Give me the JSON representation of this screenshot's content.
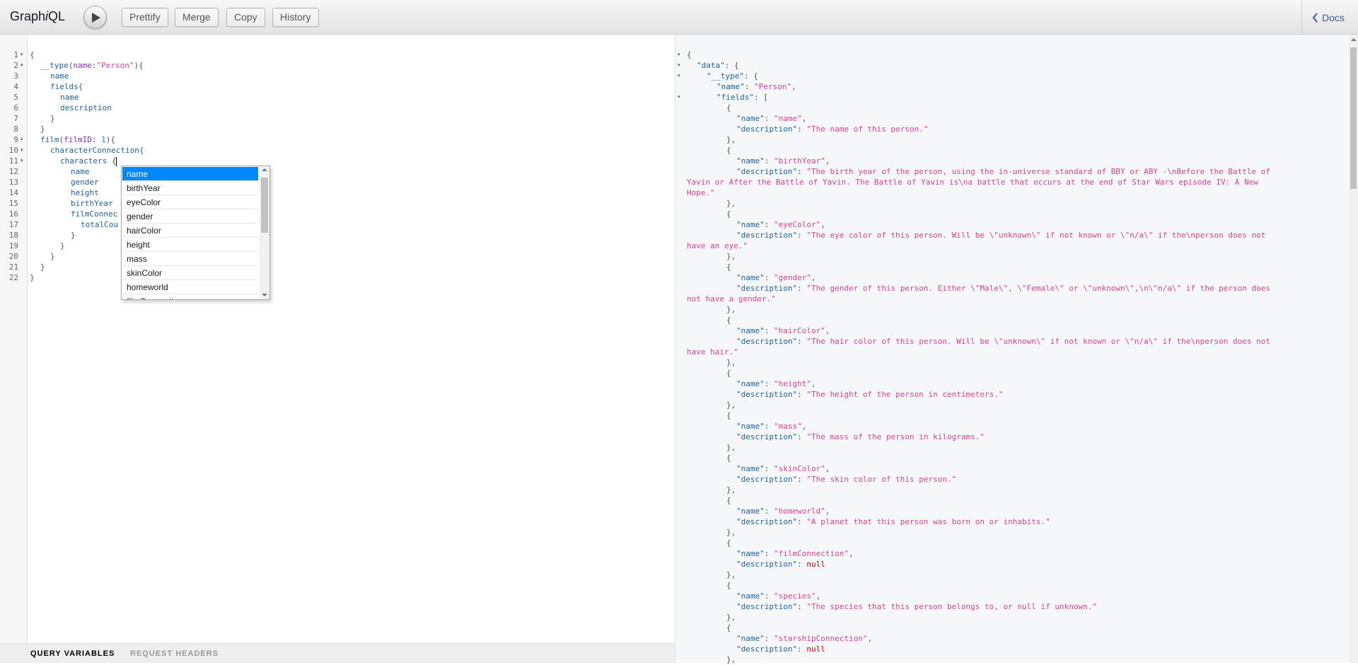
{
  "app": {
    "title_prefix": "Graph",
    "title_italic": "i",
    "title_suffix": "QL"
  },
  "toolbar": {
    "prettify": "Prettify",
    "merge": "Merge",
    "copy": "Copy",
    "history": "History",
    "docs": "Docs"
  },
  "query": {
    "line_numbers": [
      "1",
      "2",
      "3",
      "4",
      "5",
      "6",
      "7",
      "8",
      "9",
      "10",
      "11",
      "12",
      "13",
      "14",
      "15",
      "16",
      "17",
      "18",
      "19",
      "20",
      "21",
      "22"
    ],
    "l1": "{",
    "l2_field": "__type",
    "l2_arg": "name",
    "l2_str": "\"Person\"",
    "l3": "name",
    "l4": "fields",
    "l5": "name",
    "l6": "description",
    "l7": "}",
    "l8": "}",
    "l9_field": "film",
    "l9_arg": "filmID",
    "l9_num": "1",
    "l10": "characterConnection",
    "l11": "characters",
    "l12": "name",
    "l13": "gender",
    "l14": "height",
    "l15": "birthYear",
    "l16": "filmConnec",
    "l17": "totalCou",
    "l18": "}",
    "l19": "}",
    "l20": "}",
    "l21": "}",
    "l22": "}"
  },
  "autocomplete": {
    "items": [
      "name",
      "birthYear",
      "eyeColor",
      "gender",
      "hairColor",
      "height",
      "mass",
      "skinColor",
      "homeworld",
      "filmConnection"
    ],
    "selected": "name"
  },
  "bottom_tabs": {
    "variables": "Query Variables",
    "headers": "Request Headers"
  },
  "result": {
    "data_key": "\"data\"",
    "type_key": "\"__type\"",
    "name_key": "\"name\"",
    "type_name": "\"Person\"",
    "fields_key": "\"fields\"",
    "desc_key": "\"description\"",
    "fields": [
      {
        "name": "\"name\"",
        "desc": [
          "\"The name of this person.\""
        ]
      },
      {
        "name": "\"birthYear\"",
        "desc": [
          "\"The birth year of the person, using the in-universe standard of BBY or ABY -\\nBefore the Battle of",
          "Yavin or After the Battle of Yavin. The Battle of Yavin is\\na battle that occurs at the end of Star Wars episode IV: A New",
          "Hope.\""
        ]
      },
      {
        "name": "\"eyeColor\"",
        "desc": [
          "\"The eye color of this person. Will be \\\"unknown\\\" if not known or \\\"n/a\\\" if the\\nperson does not",
          "have an eye.\""
        ]
      },
      {
        "name": "\"gender\"",
        "desc": [
          "\"The gender of this person. Either \\\"Male\\\", \\\"Female\\\" or \\\"unknown\\\",\\n\\\"n/a\\\" if the person does",
          "not have a gender.\""
        ]
      },
      {
        "name": "\"hairColor\"",
        "desc": [
          "\"The hair color of this person. Will be \\\"unknown\\\" if not known or \\\"n/a\\\" if the\\nperson does not",
          "have hair.\""
        ]
      },
      {
        "name": "\"height\"",
        "desc": [
          "\"The height of the person in centimeters.\""
        ]
      },
      {
        "name": "\"mass\"",
        "desc": [
          "\"The mass of the person in kilograms.\""
        ]
      },
      {
        "name": "\"skinColor\"",
        "desc": [
          "\"The skin color of this person.\""
        ]
      },
      {
        "name": "\"homeworld\"",
        "desc": [
          "\"A planet that this person was born on or inhabits.\""
        ]
      },
      {
        "name": "\"filmConnection\"",
        "desc": [
          "null"
        ]
      },
      {
        "name": "\"species\"",
        "desc": [
          "\"The species that this person belongs to, or null if unknown.\""
        ]
      },
      {
        "name": "\"starshipConnection\"",
        "desc": [
          "null"
        ]
      }
    ]
  }
}
